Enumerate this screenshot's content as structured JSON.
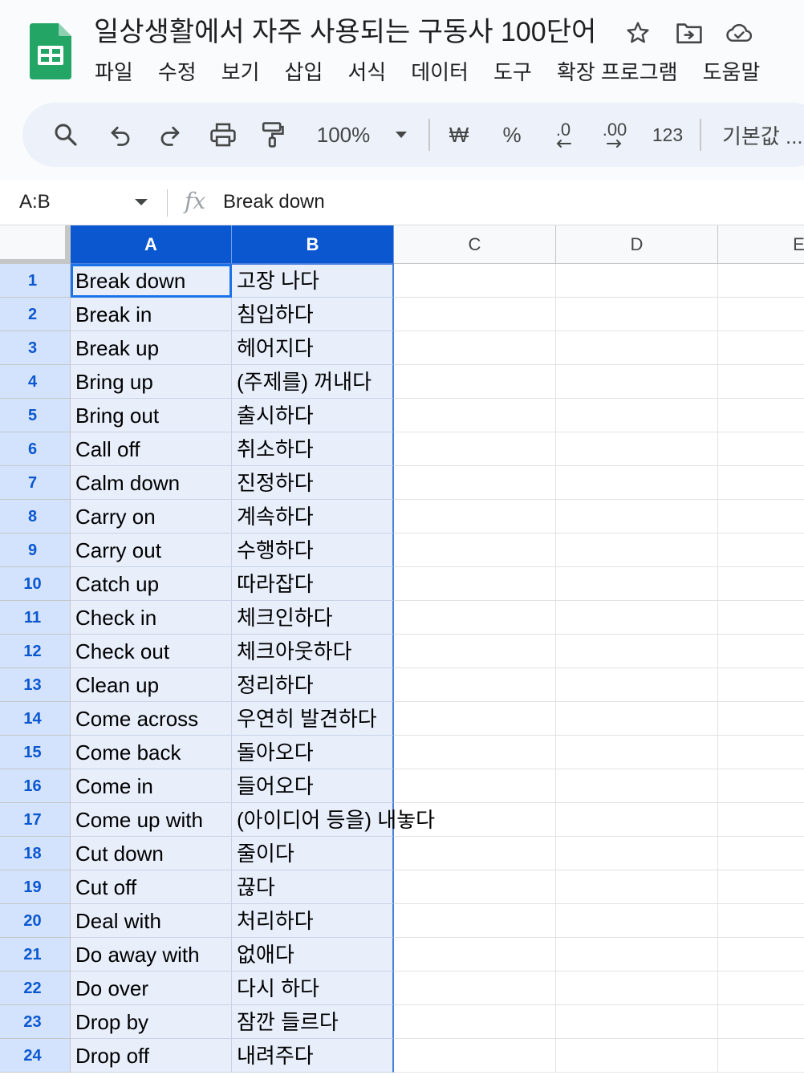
{
  "app": {
    "title": "일상생활에서 자주 사용되는 구동사 100단어",
    "icons": [
      "star-icon",
      "move-to-folder-icon",
      "cloud-saved-icon"
    ]
  },
  "menu": [
    "파일",
    "수정",
    "보기",
    "삽입",
    "서식",
    "데이터",
    "도구",
    "확장 프로그램",
    "도움말"
  ],
  "toolbar": {
    "zoom": "100%",
    "currency": "₩",
    "percent": "%",
    "decimal_decrease": ".0",
    "decimal_increase": ".00",
    "number_format": "123",
    "font": "기본값 ..."
  },
  "formula_bar": {
    "name_box": "A:B",
    "fx": "fx",
    "content": "Break down"
  },
  "colors": {
    "accent": "#0b57d0",
    "selection": "#e8effb",
    "row_header_selected": "#d3e3fd"
  },
  "grid": {
    "columns": [
      "A",
      "B",
      "C",
      "D",
      "E"
    ],
    "rows": [
      {
        "n": "1",
        "a": "Break down",
        "b": "고장 나다"
      },
      {
        "n": "2",
        "a": "Break in",
        "b": "침입하다"
      },
      {
        "n": "3",
        "a": "Break up",
        "b": "헤어지다"
      },
      {
        "n": "4",
        "a": "Bring up",
        "b": "(주제를) 꺼내다"
      },
      {
        "n": "5",
        "a": "Bring out",
        "b": "출시하다"
      },
      {
        "n": "6",
        "a": "Call off",
        "b": "취소하다"
      },
      {
        "n": "7",
        "a": "Calm down",
        "b": "진정하다"
      },
      {
        "n": "8",
        "a": "Carry on",
        "b": "계속하다"
      },
      {
        "n": "9",
        "a": "Carry out",
        "b": "수행하다"
      },
      {
        "n": "10",
        "a": "Catch up",
        "b": "따라잡다"
      },
      {
        "n": "11",
        "a": "Check in",
        "b": "체크인하다"
      },
      {
        "n": "12",
        "a": "Check out",
        "b": "체크아웃하다"
      },
      {
        "n": "13",
        "a": "Clean up",
        "b": "정리하다"
      },
      {
        "n": "14",
        "a": "Come across",
        "b": "우연히 발견하다"
      },
      {
        "n": "15",
        "a": "Come back",
        "b": "돌아오다"
      },
      {
        "n": "16",
        "a": "Come in",
        "b": "들어오다"
      },
      {
        "n": "17",
        "a": "Come up with",
        "b": "(아이디어 등을) 내놓다"
      },
      {
        "n": "18",
        "a": "Cut down",
        "b": "줄이다"
      },
      {
        "n": "19",
        "a": "Cut off",
        "b": "끊다"
      },
      {
        "n": "20",
        "a": "Deal with",
        "b": "처리하다"
      },
      {
        "n": "21",
        "a": "Do away with",
        "b": "없애다"
      },
      {
        "n": "22",
        "a": "Do over",
        "b": "다시 하다"
      },
      {
        "n": "23",
        "a": "Drop by",
        "b": "잠깐 들르다"
      },
      {
        "n": "24",
        "a": "Drop off",
        "b": "내려주다"
      }
    ]
  }
}
